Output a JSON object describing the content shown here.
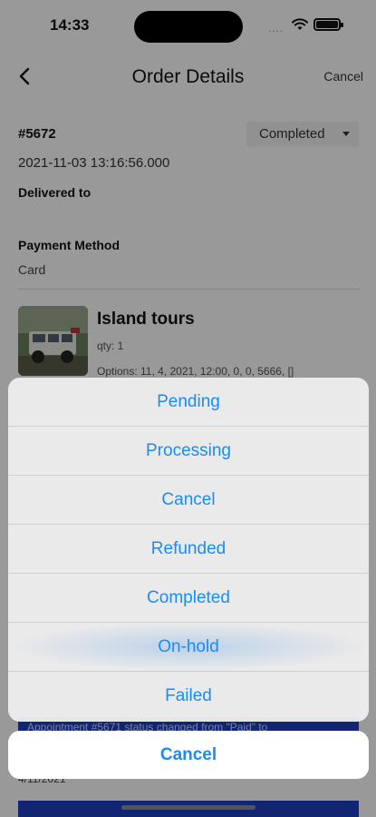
{
  "status_bar": {
    "time": "14:33",
    "signal": "...."
  },
  "nav": {
    "title": "Order Details",
    "cancel_label": "Cancel"
  },
  "order": {
    "id": "#5672",
    "status": "Completed",
    "date": "2021-11-03 13:16:56.000",
    "delivered_label": "Delivered to",
    "payment_method_label": "Payment Method",
    "payment_method_value": "Card"
  },
  "product": {
    "name": "Island tours",
    "qty": "qty: 1",
    "options": "Options: 11, 4, 2021, 12:00, 0, 0, 5666, []"
  },
  "timeline": {
    "note": "Appointment #5671 status changed from \"Paid\" to",
    "date": "4/11/2021"
  },
  "action_sheet": {
    "options": [
      "Pending",
      "Processing",
      "Cancel",
      "Refunded",
      "Completed",
      "On-hold",
      "Failed"
    ],
    "highlighted": "On-hold",
    "cancel_label": "Cancel"
  },
  "colors": {
    "accent": "#1a8cf5",
    "timeline_bg": "#1d3fbf"
  }
}
